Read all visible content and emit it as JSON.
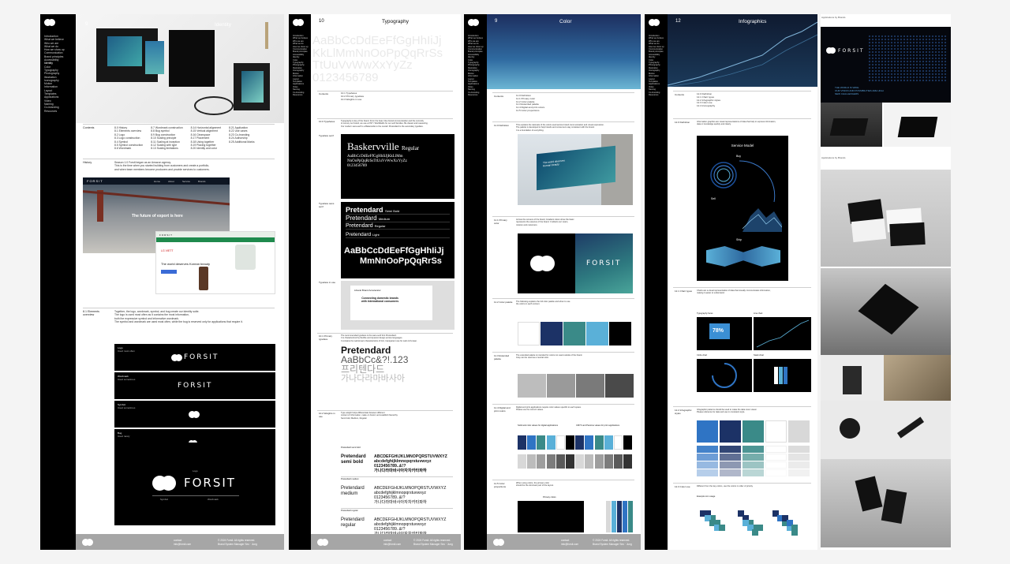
{
  "nav": [
    "Introduction",
    "What we believe",
    "Who we are",
    "What we do",
    "How we show up",
    "Communication",
    "Brand principles",
    "Accessibility",
    "Identity",
    "Color",
    "Typography",
    "Photography",
    "Illustration",
    "Iconography",
    "Motion",
    "Information",
    "Layout",
    "Templates",
    "Applications",
    "Video",
    "Naming",
    "Co-branding",
    "Resources"
  ],
  "identity": {
    "page_num": "9",
    "title": "Identity",
    "contents_label": "Contents",
    "contents_cols": [
      [
        "8.0 History",
        "8.1 Elements overview",
        "8.2 Logo",
        "8.3 Logo construction",
        "8.4 Symbol",
        "8.5 Symbol construction",
        "8.6 Wordmark"
      ],
      [
        "8.7 Wordmark construction",
        "8.8 Bug symbol",
        "8.9 Bug construction",
        "8.10 Scaling principle",
        "8.11 Scaling at inception",
        "8.12 Scaling with type",
        "8.13 Scaling limitations"
      ],
      [
        "8.14 Horizontal alignment",
        "8.15 Vertical alignment",
        "8.16 Clearspace",
        "8.17 Placement",
        "8.18 Using together",
        "8.19 Placing together",
        "8.20 Identity and color"
      ],
      [
        "8.21 Application",
        "8.22 Use cases",
        "8.23 Co-branding",
        "8.24 Authorship",
        "8.25 Additional Marks"
      ]
    ],
    "history_label": "History",
    "history_text": [
      "Season 1.0 Forsit began as an Amazon agency.",
      "This is the time when you started building from customers and create a portfolio,",
      "and when team members become producers and provide services to customers."
    ],
    "web_logo": "FORSIT",
    "web_hero": "The future of export is here",
    "web_nav": [
      "Home",
      "About",
      "Service",
      "Brands"
    ],
    "web2_logo": "FORSIT",
    "web2_brand": "LG VIETT",
    "web2_tagline": "The world deserves Korean beauty",
    "elements_label": "8.1 Elements overview",
    "elements_text": [
      "Together, the logo, wordmark, symbol, and bug create our identity suite.",
      "The logo is used most often as it contains the most information,",
      "both the expressive symbol and informative wordmark.",
      "The symbol and wordmark are used most often, while the bug is reserved only for applications that require it."
    ],
    "cards": [
      {
        "label": "Logo",
        "sub": "Used most often",
        "word": "FORSIT"
      },
      {
        "label": "Wordmark",
        "sub": "Used sometimes",
        "word": "FORSIT"
      },
      {
        "label": "Symbol",
        "sub": "Used sometimes",
        "word": ""
      },
      {
        "label": "Bug",
        "sub": "Used rarely",
        "word": ""
      }
    ],
    "big_logo": {
      "top": "Logo",
      "word": "FORSIT",
      "left": "Symbol",
      "right": "Wordmark"
    },
    "footer": {
      "l1": "contact",
      "l2": "info@forsit.com",
      "r1": "© 2024 Forsit. All rights reserved.",
      "r2": "Brand System Manager Seo · Jung"
    }
  },
  "typography": {
    "page_num": "10",
    "title": "Typography",
    "specimen": [
      "AaBbCcDdEeFfGgHhIiJj",
      "KkLlMmNnOoPpQqRrSs",
      "TtUuVvWwXxYyZz",
      "0123456789"
    ],
    "contents_label": "Contents",
    "contents": [
      "10.1 Typefaces",
      "10.2 Primary typeface",
      "10.3 Weights in use"
    ],
    "s1_label": "10.0 Typefaces",
    "s1_text": [
      "Typography is key of the brand. From the bear, blue brand communication and the currently",
      "to convey our brand, we use a FNT / Worldfields for our serif families. Be classic and reassuring.",
      "Our modern sans-serif is a Bakersville to the overall. Pretendard is the secondary typeface."
    ],
    "s2_label": "Typeface serif",
    "baskerville": {
      "name": "Baskervville",
      "weight": "Regular",
      "line1": "AaBbCcDdEeFfGgHhIiJjKkLlMm",
      "line2": "NnOoPpQqRrSsTtUuVvWwXxYyZz",
      "line3": "0123456789"
    },
    "s3_label": "Typeface sans serif",
    "pretendard_weights": [
      [
        "Pretendard",
        "Semi Bold"
      ],
      [
        "Pretendard",
        "Medium"
      ],
      [
        "Pretendard",
        "Regular"
      ],
      [
        "Pretendard",
        "Light"
      ]
    ],
    "pretendard_big": [
      "AaBbCcDdEeFfGgHhIiJj",
      "MmNnOoPpQqRrSs"
    ],
    "s4_label": "Typeface in use",
    "doc_title": "Liberal Brand Accelerator",
    "doc_heading": [
      "Connecting domestic brands",
      "with international consumers"
    ],
    "s5_label": "10.1 Primary typeface",
    "s5_text": [
      "The recommended typeface is the sans-serif font Pretendard.",
      "It is characterized by flexible and dynamic design across languages.",
      "It contains the well-known characteristics of font, transparent use for Latin & Korean."
    ],
    "primary_specimen": [
      "Pretendard",
      "AaBbCc&?!.123",
      "프리텐다드",
      "가나다라마바사아"
    ],
    "s6_label": "10.2 Weights in use",
    "s6_text": [
      "Type weight helps differentiate between different",
      "content of information, make on brand, and establish hierarchy.",
      "Semi bold, Medium, Regular"
    ],
    "weights": [
      {
        "caption": "Pretendard semi bold",
        "name": [
          "Pretendard",
          "semi bold"
        ],
        "lines": [
          "ABCDEFGHIJKLMNOPQRSTUVWXYZ",
          "abcdefghijklmnopqrstuvwxyz",
          "0123456789..&!?",
          "가나다라마바사아자차카타파하"
        ]
      },
      {
        "caption": "Pretendard medium",
        "name": [
          "Pretendard",
          "medium"
        ],
        "lines": [
          "ABCDEFGHIJKLMNOPQRSTUVWXYZ",
          "abcdefghijklmnopqrstuvwxyz",
          "0123456789..&!?",
          "가나다라마바사아자차카타파하"
        ]
      },
      {
        "caption": "Pretendard regular",
        "name": [
          "Pretendard",
          "regular"
        ],
        "lines": [
          "ABCDEFGHIJKLMNOPQRSTUVWXYZ",
          "abcdefghijklmnopqrstuvwxyz",
          "0123456789..&!?",
          "가나다라마바사아자차카타파하"
        ]
      }
    ],
    "footer": {
      "l1": "contact",
      "l2": "info@forsit.com",
      "r1": "© 2024 Forsit. All rights reserved.",
      "r2": "Brand System Manager Seo · Jung"
    }
  },
  "color": {
    "page_num": "9",
    "title": "Color",
    "contents_label": "Contents",
    "contents": [
      "11.0 Definition",
      "11.1 Primary color",
      "11.2 Color palette",
      "11.3 Extended palette",
      "11.4 Digital and print colors",
      "11.5 Color proportions"
    ],
    "s1_label": "11.0 Definition",
    "s1_text": [
      "This explains the rationale of the colors used across brand communication and visual expression.",
      "The palette is developed to help brands and consumers stay consistent with the brand.",
      "It is a foundation of everything."
    ],
    "billboard_text": [
      "The world deserves",
      "Korean beauty"
    ],
    "s2_label": "11.1 Primary color",
    "s2_text": [
      "Across the screens of the brand, Gradient colors show the basic",
      "represents the essence of the brand. It reflects our vision,",
      "mission and customers."
    ],
    "primary_word": "FORSIT",
    "s3_label": "11.2 Color palette",
    "s3_text": [
      "The following explains the full color palette and when to use",
      "the colors in each context."
    ],
    "s4_label": "11.3 Extended palette",
    "s4_text": [
      "The extended palette is intended for colors not used outside of the brand.",
      "Gray can be used as a neutral color."
    ],
    "s5_label": "11.4 Digital and print colors",
    "s5_text": [
      "Digital and print applications require color values specific to each space.",
      "Please use the correct values."
    ],
    "dp_left": "Solid and color values for digital applications",
    "dp_right": "CMYK and Pantone values for print applications",
    "s6_label": "11.5 Color proportions",
    "s6_text": [
      "When using colors, the primary color",
      "should be the dominant part of the layout."
    ],
    "prop_top": "Primary colors",
    "prop_bottom": "Supporting colors",
    "footer": {
      "l1": "contact",
      "l2": "info@forsit.com",
      "r1": "© 2024 Forsit. All rights reserved.",
      "r2": "Brand System Manager Seo · Jung"
    }
  },
  "infographics": {
    "page_num": "12",
    "title": "Infographics",
    "contents_label": "Contents",
    "contents": [
      "12.0 Definition",
      "12.1 Chart types",
      "12.2 Infographic styles",
      "12.3 Color use",
      "12.4 Iconography"
    ],
    "s1_label": "12.0 Definition",
    "s1_text": [
      "Information graphics are visual representations of data that help to express information,",
      "data or knowledge quickly and clearly."
    ],
    "poster_title": "Service Model",
    "poster_sections": [
      "Buy",
      "Sell",
      "Ship"
    ],
    "s2_label": "12.1 Chart types",
    "s2_text": [
      "Charts are a visual representation of data that visually communicates information,",
      "making it easier to understand."
    ],
    "chart_labels": [
      "Typography focus",
      "Line chart",
      "Circle chart",
      "Stack chart"
    ],
    "stat_value": "78%",
    "s3_label": "12.2 Infographic styles",
    "s3_text": [
      "Infographic patterns should be used to make the data more visual.",
      "Please reference for data and use in consistent style."
    ],
    "s4_label": "12.3 Color use",
    "s4_text": [
      "Different from the key colors, use the colors in order of priority."
    ],
    "icons_label": "Example icon usage",
    "footer": {
      "l1": "contact",
      "l2": "info@forsit.com",
      "r1": "© 2024 Forsit. All rights reserved.",
      "r2": "Brand System Manager Seo · Jung"
    }
  },
  "applications": {
    "label1": "Applications by Brands",
    "word": "FORSIT",
    "hero_line1": "THE WORLD IS WIDE",
    "hero_line2": "OUR VISION AND POSSIBILITIES ARE HIGH",
    "hero_line3": "NEW CHALLENGERS",
    "label2": "Applications by Brands"
  },
  "colors": {
    "navy": "#1c3266",
    "blue": "#2f74c4",
    "teal": "#3a8a88",
    "sky": "#5ab0d8",
    "black": "#000000",
    "gray": "#a6a6a6"
  }
}
